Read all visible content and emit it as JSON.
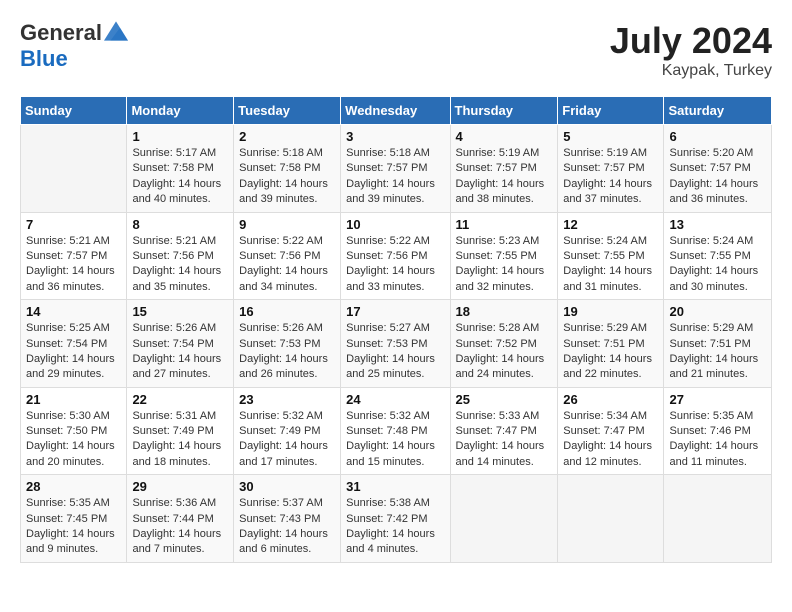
{
  "logo": {
    "general": "General",
    "blue": "Blue"
  },
  "title": {
    "month_year": "July 2024",
    "location": "Kaypak, Turkey"
  },
  "weekdays": [
    "Sunday",
    "Monday",
    "Tuesday",
    "Wednesday",
    "Thursday",
    "Friday",
    "Saturday"
  ],
  "weeks": [
    [
      {
        "day": "",
        "sunrise": "",
        "sunset": "",
        "daylight": ""
      },
      {
        "day": "1",
        "sunrise": "Sunrise: 5:17 AM",
        "sunset": "Sunset: 7:58 PM",
        "daylight": "Daylight: 14 hours and 40 minutes."
      },
      {
        "day": "2",
        "sunrise": "Sunrise: 5:18 AM",
        "sunset": "Sunset: 7:58 PM",
        "daylight": "Daylight: 14 hours and 39 minutes."
      },
      {
        "day": "3",
        "sunrise": "Sunrise: 5:18 AM",
        "sunset": "Sunset: 7:57 PM",
        "daylight": "Daylight: 14 hours and 39 minutes."
      },
      {
        "day": "4",
        "sunrise": "Sunrise: 5:19 AM",
        "sunset": "Sunset: 7:57 PM",
        "daylight": "Daylight: 14 hours and 38 minutes."
      },
      {
        "day": "5",
        "sunrise": "Sunrise: 5:19 AM",
        "sunset": "Sunset: 7:57 PM",
        "daylight": "Daylight: 14 hours and 37 minutes."
      },
      {
        "day": "6",
        "sunrise": "Sunrise: 5:20 AM",
        "sunset": "Sunset: 7:57 PM",
        "daylight": "Daylight: 14 hours and 36 minutes."
      }
    ],
    [
      {
        "day": "7",
        "sunrise": "Sunrise: 5:21 AM",
        "sunset": "Sunset: 7:57 PM",
        "daylight": "Daylight: 14 hours and 36 minutes."
      },
      {
        "day": "8",
        "sunrise": "Sunrise: 5:21 AM",
        "sunset": "Sunset: 7:56 PM",
        "daylight": "Daylight: 14 hours and 35 minutes."
      },
      {
        "day": "9",
        "sunrise": "Sunrise: 5:22 AM",
        "sunset": "Sunset: 7:56 PM",
        "daylight": "Daylight: 14 hours and 34 minutes."
      },
      {
        "day": "10",
        "sunrise": "Sunrise: 5:22 AM",
        "sunset": "Sunset: 7:56 PM",
        "daylight": "Daylight: 14 hours and 33 minutes."
      },
      {
        "day": "11",
        "sunrise": "Sunrise: 5:23 AM",
        "sunset": "Sunset: 7:55 PM",
        "daylight": "Daylight: 14 hours and 32 minutes."
      },
      {
        "day": "12",
        "sunrise": "Sunrise: 5:24 AM",
        "sunset": "Sunset: 7:55 PM",
        "daylight": "Daylight: 14 hours and 31 minutes."
      },
      {
        "day": "13",
        "sunrise": "Sunrise: 5:24 AM",
        "sunset": "Sunset: 7:55 PM",
        "daylight": "Daylight: 14 hours and 30 minutes."
      }
    ],
    [
      {
        "day": "14",
        "sunrise": "Sunrise: 5:25 AM",
        "sunset": "Sunset: 7:54 PM",
        "daylight": "Daylight: 14 hours and 29 minutes."
      },
      {
        "day": "15",
        "sunrise": "Sunrise: 5:26 AM",
        "sunset": "Sunset: 7:54 PM",
        "daylight": "Daylight: 14 hours and 27 minutes."
      },
      {
        "day": "16",
        "sunrise": "Sunrise: 5:26 AM",
        "sunset": "Sunset: 7:53 PM",
        "daylight": "Daylight: 14 hours and 26 minutes."
      },
      {
        "day": "17",
        "sunrise": "Sunrise: 5:27 AM",
        "sunset": "Sunset: 7:53 PM",
        "daylight": "Daylight: 14 hours and 25 minutes."
      },
      {
        "day": "18",
        "sunrise": "Sunrise: 5:28 AM",
        "sunset": "Sunset: 7:52 PM",
        "daylight": "Daylight: 14 hours and 24 minutes."
      },
      {
        "day": "19",
        "sunrise": "Sunrise: 5:29 AM",
        "sunset": "Sunset: 7:51 PM",
        "daylight": "Daylight: 14 hours and 22 minutes."
      },
      {
        "day": "20",
        "sunrise": "Sunrise: 5:29 AM",
        "sunset": "Sunset: 7:51 PM",
        "daylight": "Daylight: 14 hours and 21 minutes."
      }
    ],
    [
      {
        "day": "21",
        "sunrise": "Sunrise: 5:30 AM",
        "sunset": "Sunset: 7:50 PM",
        "daylight": "Daylight: 14 hours and 20 minutes."
      },
      {
        "day": "22",
        "sunrise": "Sunrise: 5:31 AM",
        "sunset": "Sunset: 7:49 PM",
        "daylight": "Daylight: 14 hours and 18 minutes."
      },
      {
        "day": "23",
        "sunrise": "Sunrise: 5:32 AM",
        "sunset": "Sunset: 7:49 PM",
        "daylight": "Daylight: 14 hours and 17 minutes."
      },
      {
        "day": "24",
        "sunrise": "Sunrise: 5:32 AM",
        "sunset": "Sunset: 7:48 PM",
        "daylight": "Daylight: 14 hours and 15 minutes."
      },
      {
        "day": "25",
        "sunrise": "Sunrise: 5:33 AM",
        "sunset": "Sunset: 7:47 PM",
        "daylight": "Daylight: 14 hours and 14 minutes."
      },
      {
        "day": "26",
        "sunrise": "Sunrise: 5:34 AM",
        "sunset": "Sunset: 7:47 PM",
        "daylight": "Daylight: 14 hours and 12 minutes."
      },
      {
        "day": "27",
        "sunrise": "Sunrise: 5:35 AM",
        "sunset": "Sunset: 7:46 PM",
        "daylight": "Daylight: 14 hours and 11 minutes."
      }
    ],
    [
      {
        "day": "28",
        "sunrise": "Sunrise: 5:35 AM",
        "sunset": "Sunset: 7:45 PM",
        "daylight": "Daylight: 14 hours and 9 minutes."
      },
      {
        "day": "29",
        "sunrise": "Sunrise: 5:36 AM",
        "sunset": "Sunset: 7:44 PM",
        "daylight": "Daylight: 14 hours and 7 minutes."
      },
      {
        "day": "30",
        "sunrise": "Sunrise: 5:37 AM",
        "sunset": "Sunset: 7:43 PM",
        "daylight": "Daylight: 14 hours and 6 minutes."
      },
      {
        "day": "31",
        "sunrise": "Sunrise: 5:38 AM",
        "sunset": "Sunset: 7:42 PM",
        "daylight": "Daylight: 14 hours and 4 minutes."
      },
      {
        "day": "",
        "sunrise": "",
        "sunset": "",
        "daylight": ""
      },
      {
        "day": "",
        "sunrise": "",
        "sunset": "",
        "daylight": ""
      },
      {
        "day": "",
        "sunrise": "",
        "sunset": "",
        "daylight": ""
      }
    ]
  ]
}
